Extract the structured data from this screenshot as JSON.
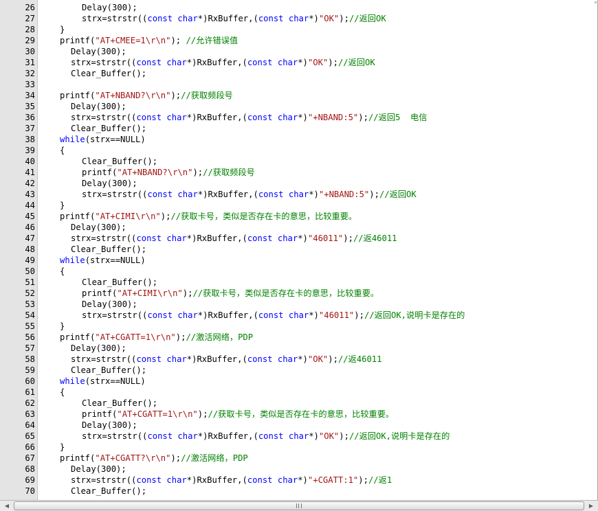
{
  "editor": {
    "lines": [
      {
        "n": "26",
        "indent": 2,
        "parts": [
          [
            "p",
            "Delay(300);"
          ]
        ]
      },
      {
        "n": "27",
        "indent": 2,
        "parts": [
          [
            "p",
            "strx=strstr(("
          ],
          [
            "k",
            "const char"
          ],
          [
            "p",
            "*)RxBuffer,("
          ],
          [
            "k",
            "const char"
          ],
          [
            "p",
            "*)"
          ],
          [
            "s",
            "\"OK\""
          ],
          [
            "p",
            ");"
          ],
          [
            "c",
            "//返回OK"
          ]
        ]
      },
      {
        "n": "28",
        "indent": 0,
        "parts": [
          [
            "p",
            "}"
          ]
        ]
      },
      {
        "n": "29",
        "indent": 0,
        "parts": [
          [
            "p",
            "printf("
          ],
          [
            "s",
            "\"AT+CMEE=1\\r\\n\""
          ],
          [
            "p",
            ");"
          ],
          [
            "c",
            " //允许错误值"
          ]
        ]
      },
      {
        "n": "30",
        "indent": 1,
        "parts": [
          [
            "p",
            "Delay(300);"
          ]
        ]
      },
      {
        "n": "31",
        "indent": 1,
        "parts": [
          [
            "p",
            "strx=strstr(("
          ],
          [
            "k",
            "const char"
          ],
          [
            "p",
            "*)RxBuffer,("
          ],
          [
            "k",
            "const char"
          ],
          [
            "p",
            "*)"
          ],
          [
            "s",
            "\"OK\""
          ],
          [
            "p",
            ");"
          ],
          [
            "c",
            "//返回OK"
          ]
        ]
      },
      {
        "n": "32",
        "indent": 1,
        "parts": [
          [
            "p",
            "Clear_Buffer();"
          ]
        ]
      },
      {
        "n": "33",
        "indent": 0,
        "parts": []
      },
      {
        "n": "34",
        "indent": 0,
        "parts": [
          [
            "p",
            "printf("
          ],
          [
            "s",
            "\"AT+NBAND?\\r\\n\""
          ],
          [
            "p",
            ");"
          ],
          [
            "c",
            "//获取频段号"
          ]
        ]
      },
      {
        "n": "35",
        "indent": 1,
        "parts": [
          [
            "p",
            "Delay(300);"
          ]
        ]
      },
      {
        "n": "36",
        "indent": 1,
        "parts": [
          [
            "p",
            "strx=strstr(("
          ],
          [
            "k",
            "const char"
          ],
          [
            "p",
            "*)RxBuffer,("
          ],
          [
            "k",
            "const char"
          ],
          [
            "p",
            "*)"
          ],
          [
            "s",
            "\"+NBAND:5\""
          ],
          [
            "p",
            ");"
          ],
          [
            "c",
            "//返回5  电信"
          ]
        ]
      },
      {
        "n": "37",
        "indent": 1,
        "parts": [
          [
            "p",
            "Clear_Buffer();"
          ]
        ]
      },
      {
        "n": "38",
        "indent": 0,
        "parts": [
          [
            "k",
            "while"
          ],
          [
            "p",
            "(strx==NULL)"
          ]
        ]
      },
      {
        "n": "39",
        "indent": 0,
        "parts": [
          [
            "p",
            "{"
          ]
        ]
      },
      {
        "n": "40",
        "indent": 2,
        "parts": [
          [
            "p",
            "Clear_Buffer();"
          ]
        ]
      },
      {
        "n": "41",
        "indent": 2,
        "parts": [
          [
            "p",
            "printf("
          ],
          [
            "s",
            "\"AT+NBAND?\\r\\n\""
          ],
          [
            "p",
            ");"
          ],
          [
            "c",
            "//获取频段号"
          ]
        ]
      },
      {
        "n": "42",
        "indent": 2,
        "parts": [
          [
            "p",
            "Delay(300);"
          ]
        ]
      },
      {
        "n": "43",
        "indent": 2,
        "parts": [
          [
            "p",
            "strx=strstr(("
          ],
          [
            "k",
            "const char"
          ],
          [
            "p",
            "*)RxBuffer,("
          ],
          [
            "k",
            "const char"
          ],
          [
            "p",
            "*)"
          ],
          [
            "s",
            "\"+NBAND:5\""
          ],
          [
            "p",
            ");"
          ],
          [
            "c",
            "//返回OK"
          ]
        ]
      },
      {
        "n": "44",
        "indent": 0,
        "parts": [
          [
            "p",
            "}"
          ]
        ]
      },
      {
        "n": "45",
        "indent": 0,
        "parts": [
          [
            "p",
            "printf("
          ],
          [
            "s",
            "\"AT+CIMI\\r\\n\""
          ],
          [
            "p",
            ");"
          ],
          [
            "c",
            "//获取卡号，类似是否存在卡的意思，比较重要。"
          ]
        ]
      },
      {
        "n": "46",
        "indent": 1,
        "parts": [
          [
            "p",
            "Delay(300);"
          ]
        ]
      },
      {
        "n": "47",
        "indent": 1,
        "parts": [
          [
            "p",
            "strx=strstr(("
          ],
          [
            "k",
            "const char"
          ],
          [
            "p",
            "*)RxBuffer,("
          ],
          [
            "k",
            "const char"
          ],
          [
            "p",
            "*)"
          ],
          [
            "s",
            "\"46011\""
          ],
          [
            "p",
            ");"
          ],
          [
            "c",
            "//返46011"
          ]
        ]
      },
      {
        "n": "48",
        "indent": 1,
        "parts": [
          [
            "p",
            "Clear_Buffer();"
          ]
        ]
      },
      {
        "n": "49",
        "indent": 0,
        "parts": [
          [
            "k",
            "while"
          ],
          [
            "p",
            "(strx==NULL)"
          ]
        ]
      },
      {
        "n": "50",
        "indent": 0,
        "parts": [
          [
            "p",
            "{"
          ]
        ]
      },
      {
        "n": "51",
        "indent": 2,
        "parts": [
          [
            "p",
            "Clear_Buffer();"
          ]
        ]
      },
      {
        "n": "52",
        "indent": 2,
        "parts": [
          [
            "p",
            "printf("
          ],
          [
            "s",
            "\"AT+CIMI\\r\\n\""
          ],
          [
            "p",
            ");"
          ],
          [
            "c",
            "//获取卡号，类似是否存在卡的意思，比较重要。"
          ]
        ]
      },
      {
        "n": "53",
        "indent": 2,
        "parts": [
          [
            "p",
            "Delay(300);"
          ]
        ]
      },
      {
        "n": "54",
        "indent": 2,
        "parts": [
          [
            "p",
            "strx=strstr(("
          ],
          [
            "k",
            "const char"
          ],
          [
            "p",
            "*)RxBuffer,("
          ],
          [
            "k",
            "const char"
          ],
          [
            "p",
            "*)"
          ],
          [
            "s",
            "\"46011\""
          ],
          [
            "p",
            ");"
          ],
          [
            "c",
            "//返回OK,说明卡是存在的"
          ]
        ]
      },
      {
        "n": "55",
        "indent": 0,
        "parts": [
          [
            "p",
            "}"
          ]
        ]
      },
      {
        "n": "56",
        "indent": 0,
        "parts": [
          [
            "p",
            "printf("
          ],
          [
            "s",
            "\"AT+CGATT=1\\r\\n\""
          ],
          [
            "p",
            ");"
          ],
          [
            "c",
            "//激活网络，PDP"
          ]
        ]
      },
      {
        "n": "57",
        "indent": 1,
        "parts": [
          [
            "p",
            "Delay(300);"
          ]
        ]
      },
      {
        "n": "58",
        "indent": 1,
        "parts": [
          [
            "p",
            "strx=strstr(("
          ],
          [
            "k",
            "const char"
          ],
          [
            "p",
            "*)RxBuffer,("
          ],
          [
            "k",
            "const char"
          ],
          [
            "p",
            "*)"
          ],
          [
            "s",
            "\"OK\""
          ],
          [
            "p",
            ");"
          ],
          [
            "c",
            "//返46011"
          ]
        ]
      },
      {
        "n": "59",
        "indent": 1,
        "parts": [
          [
            "p",
            "Clear_Buffer();"
          ]
        ]
      },
      {
        "n": "60",
        "indent": 0,
        "parts": [
          [
            "k",
            "while"
          ],
          [
            "p",
            "(strx==NULL)"
          ]
        ]
      },
      {
        "n": "61",
        "indent": 0,
        "parts": [
          [
            "p",
            "{"
          ]
        ]
      },
      {
        "n": "62",
        "indent": 2,
        "parts": [
          [
            "p",
            "Clear_Buffer();"
          ]
        ]
      },
      {
        "n": "63",
        "indent": 2,
        "parts": [
          [
            "p",
            "printf("
          ],
          [
            "s",
            "\"AT+CGATT=1\\r\\n\""
          ],
          [
            "p",
            ");"
          ],
          [
            "c",
            "//获取卡号，类似是否存在卡的意思，比较重要。"
          ]
        ]
      },
      {
        "n": "64",
        "indent": 2,
        "parts": [
          [
            "p",
            "Delay(300);"
          ]
        ]
      },
      {
        "n": "65",
        "indent": 2,
        "parts": [
          [
            "p",
            "strx=strstr(("
          ],
          [
            "k",
            "const char"
          ],
          [
            "p",
            "*)RxBuffer,("
          ],
          [
            "k",
            "const char"
          ],
          [
            "p",
            "*)"
          ],
          [
            "s",
            "\"OK\""
          ],
          [
            "p",
            ");"
          ],
          [
            "c",
            "//返回OK,说明卡是存在的"
          ]
        ]
      },
      {
        "n": "66",
        "indent": 0,
        "parts": [
          [
            "p",
            "}"
          ]
        ]
      },
      {
        "n": "67",
        "indent": 0,
        "parts": [
          [
            "p",
            "printf("
          ],
          [
            "s",
            "\"AT+CGATT?\\r\\n\""
          ],
          [
            "p",
            ");"
          ],
          [
            "c",
            "//激活网络，PDP"
          ]
        ]
      },
      {
        "n": "68",
        "indent": 1,
        "parts": [
          [
            "p",
            "Delay(300);"
          ]
        ]
      },
      {
        "n": "69",
        "indent": 1,
        "parts": [
          [
            "p",
            "strx=strstr(("
          ],
          [
            "k",
            "const char"
          ],
          [
            "p",
            "*)RxBuffer,("
          ],
          [
            "k",
            "const char"
          ],
          [
            "p",
            "*)"
          ],
          [
            "s",
            "\"+CGATT:1\""
          ],
          [
            "p",
            ");"
          ],
          [
            "c",
            "//返1"
          ]
        ]
      },
      {
        "n": "70",
        "indent": 1,
        "parts": [
          [
            "p",
            "Clear_Buffer();"
          ]
        ]
      }
    ]
  },
  "scrollbar": {
    "left_icon": "arrow-left-icon",
    "right_icon": "arrow-right-icon",
    "grip_icon": "grip-icon"
  },
  "colors": {
    "keyword": "#0000ff",
    "string": "#a31515",
    "comment": "#008000",
    "gutter": "#e4e4e4"
  }
}
